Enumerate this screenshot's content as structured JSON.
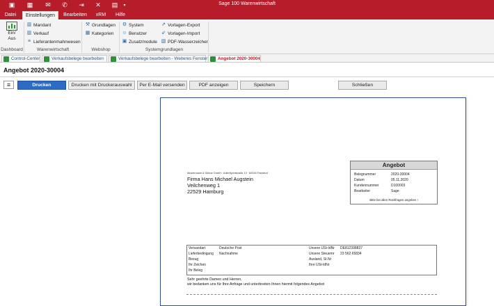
{
  "window": {
    "title": "Sage 100 Warenwirtschaft",
    "quick_access": [
      "save-icon",
      "calculator-icon",
      "email-icon",
      "phone-icon",
      "exit-icon",
      "close-icon",
      "document-icon",
      "dropdown-icon"
    ]
  },
  "menu": [
    "Datei",
    "Einstellungen",
    "Bearbeiten",
    "xRM",
    "Hilfe"
  ],
  "ribbon": {
    "dashboard": {
      "button": "Ein/\nAus",
      "label": "Dashboard"
    },
    "warenwirtschaft": {
      "items": [
        "Mandant",
        "Verkauf",
        "Lieferantenmahnwesen"
      ],
      "label": "Warenwirtschaft"
    },
    "webshop": {
      "items": [
        "Grundlagen",
        "Kategorien"
      ],
      "label": "Webshop"
    },
    "systemgrundlagen": {
      "col1": [
        "System",
        "Benutzer",
        "Zusatzmodule"
      ],
      "col2": [
        "Vorlagen-Export",
        "Vorlagen-Import",
        "PDF-Wasserzeichen"
      ],
      "label": "Systemgrundlagen"
    }
  },
  "doc_tabs": [
    "Control-Center",
    "Verkaufsbelege bearbeiten",
    "Verkaufsbelege bearbeiten - Weiteres Fenster",
    "Angebot 2020-30004"
  ],
  "heading": "Angebot 2020-30004",
  "buttons": {
    "print": "Drucken",
    "print_select": "Drucken mit Druckerauswahl",
    "email": "Per E-Mail versenden",
    "pdf": "PDF anzeigen",
    "save": "Speichern",
    "close": "Schließen"
  },
  "document": {
    "sender_line": "Mustermann & Söhne GmbH · Adlerflychtstraße 13 · 60318 Frankfurt",
    "address": [
      "Firma Hans Michael Augstein",
      "Veilchenweg 1",
      "22529 Hamburg"
    ],
    "offer": {
      "title": "Angebot",
      "rows": [
        {
          "label": "Belegnummer",
          "value": "2020-30004"
        },
        {
          "label": "Datum",
          "value": "05.11.2020"
        },
        {
          "label": "Kundennummer",
          "value": "D100003"
        },
        {
          "label": "Bearbeiter",
          "value": "Sage"
        }
      ],
      "note": "Bitte bei allen Rückfragen angeben !"
    },
    "info_left": [
      {
        "label": "Versandart",
        "value": "Deutsche Post"
      },
      {
        "label": "Lieferbedingung",
        "value": "Nachnahme"
      },
      {
        "label": "Bezug",
        "value": ""
      },
      {
        "label": "Ihr Zeichen",
        "value": ""
      },
      {
        "label": "Ihr Beleg",
        "value": ""
      }
    ],
    "info_right": [
      {
        "label": "Unsere USt-IdNr",
        "value": "DE812398837"
      },
      {
        "label": "Unsere Steuernr",
        "value": "23 562 65834"
      },
      {
        "label": "Ausland, St.Nr",
        "value": ""
      },
      {
        "label": "Ihre USt-IdNr",
        "value": ""
      }
    ],
    "greeting": "Sehr geehrte Damen und Herren,",
    "intro": "wir bedanken uns für Ihre Anfrage und unterbreiten Ihnen hiermit folgendes Angebot"
  }
}
